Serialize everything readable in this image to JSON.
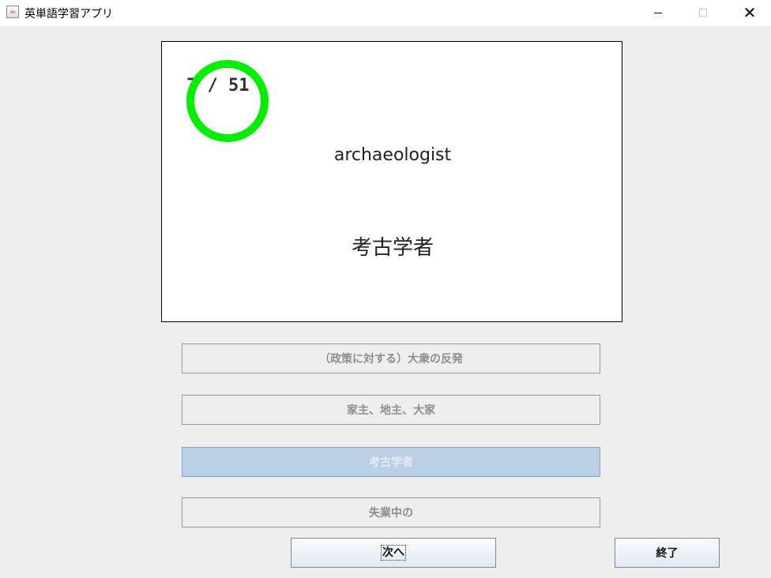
{
  "window": {
    "title": "英単語学習アプリ",
    "controls": [
      "minimize-icon",
      "maximize-icon",
      "close-icon"
    ]
  },
  "card": {
    "counter": "7 / 51",
    "english": "archaeologist",
    "japanese": "考古学者",
    "result_mark": "green-circle",
    "result_color": "#00ee00"
  },
  "choices": [
    {
      "label": "（政策に対する）大衆の反発",
      "selected": false
    },
    {
      "label": "家主、地主、大家",
      "selected": false
    },
    {
      "label": "考古学者",
      "selected": true
    },
    {
      "label": "失業中の",
      "selected": false
    }
  ],
  "buttons": {
    "next": "次へ",
    "quit": "終了"
  },
  "colors": {
    "background": "#eeeeee",
    "selected_choice": "#b8cfe5",
    "correct_ring": "#00ee00"
  }
}
